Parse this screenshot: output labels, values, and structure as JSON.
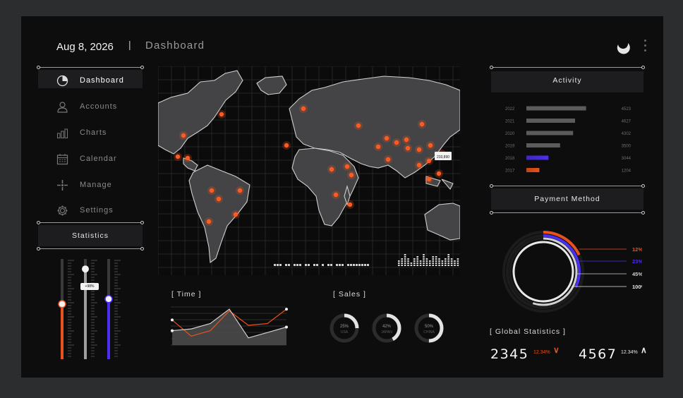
{
  "header": {
    "date": "Aug 8, 2026",
    "separator": "|",
    "title": "Dashboard"
  },
  "sidebar": {
    "items": [
      {
        "label": "Dashboard",
        "icon": "pie-chart-icon",
        "active": true
      },
      {
        "label": "Accounts",
        "icon": "user-icon",
        "active": false
      },
      {
        "label": "Charts",
        "icon": "bar-chart-icon",
        "active": false
      },
      {
        "label": "Calendar",
        "icon": "calendar-icon",
        "active": false
      },
      {
        "label": "Manage",
        "icon": "crosshair-icon",
        "active": false
      },
      {
        "label": "Settings",
        "icon": "gear-icon",
        "active": false
      }
    ],
    "statistics_label": "Statistics",
    "slider_badge": "+98%",
    "sliders": [
      {
        "level": 0.55,
        "color": "#e8521c"
      },
      {
        "level": 0.9,
        "color": "#9e9e9e"
      },
      {
        "level": 0.6,
        "color": "#4a2ff0"
      }
    ]
  },
  "map": {
    "tooltip": "233,890"
  },
  "time_chart": {
    "label": "[ Time ]",
    "series": [
      {
        "color": "#e8521c",
        "values": [
          70,
          25,
          40,
          95,
          55,
          60,
          100
        ]
      },
      {
        "color": "#cfcfcf",
        "values": [
          40,
          45,
          60,
          100,
          20,
          35,
          50
        ]
      }
    ]
  },
  "sales": {
    "label": "[ Sales ]",
    "donuts": [
      {
        "pct": "25%",
        "country": "USA",
        "value": 0.25
      },
      {
        "pct": "42%",
        "country": "JAPAN",
        "value": 0.42
      },
      {
        "pct": "50%",
        "country": "CHINA",
        "value": 0.5
      }
    ]
  },
  "activity": {
    "label": "Activity",
    "rows": [
      {
        "year": "2022",
        "value": "4523",
        "bar": 0.92,
        "color": "#5a5a5a"
      },
      {
        "year": "2021",
        "value": "4627",
        "bar": 0.75,
        "color": "#5a5a5a"
      },
      {
        "year": "2020",
        "value": "4302",
        "bar": 0.72,
        "color": "#5a5a5a"
      },
      {
        "year": "2019",
        "value": "3500",
        "bar": 0.52,
        "color": "#5a5a5a"
      },
      {
        "year": "2018",
        "value": "3044",
        "bar": 0.34,
        "color": "#4a2ff0"
      },
      {
        "year": "2017",
        "value": "1204",
        "bar": 0.2,
        "color": "#e8521c"
      }
    ]
  },
  "payment": {
    "label": "Payment Method",
    "rings": [
      {
        "pct": "12%",
        "color": "#e8521c"
      },
      {
        "pct": "23%",
        "color": "#4a2ff0"
      },
      {
        "pct": "45%",
        "color": "#d0d0d0"
      },
      {
        "pct": "100%",
        "color": "#e8e8e8"
      }
    ]
  },
  "global": {
    "label": "[ Global Statistics ]",
    "stats": [
      {
        "number": "2345",
        "change": "12.34%",
        "arrow": "∨",
        "color": "#e8521c"
      },
      {
        "number": "4567",
        "change": "12.34%",
        "arrow": "∧",
        "color": "#e8e8e8"
      }
    ]
  },
  "colors": {
    "accent": "#e8521c",
    "blue": "#4a2ff0",
    "panel": "#1d1d1f",
    "bg": "#0d0d0e"
  }
}
